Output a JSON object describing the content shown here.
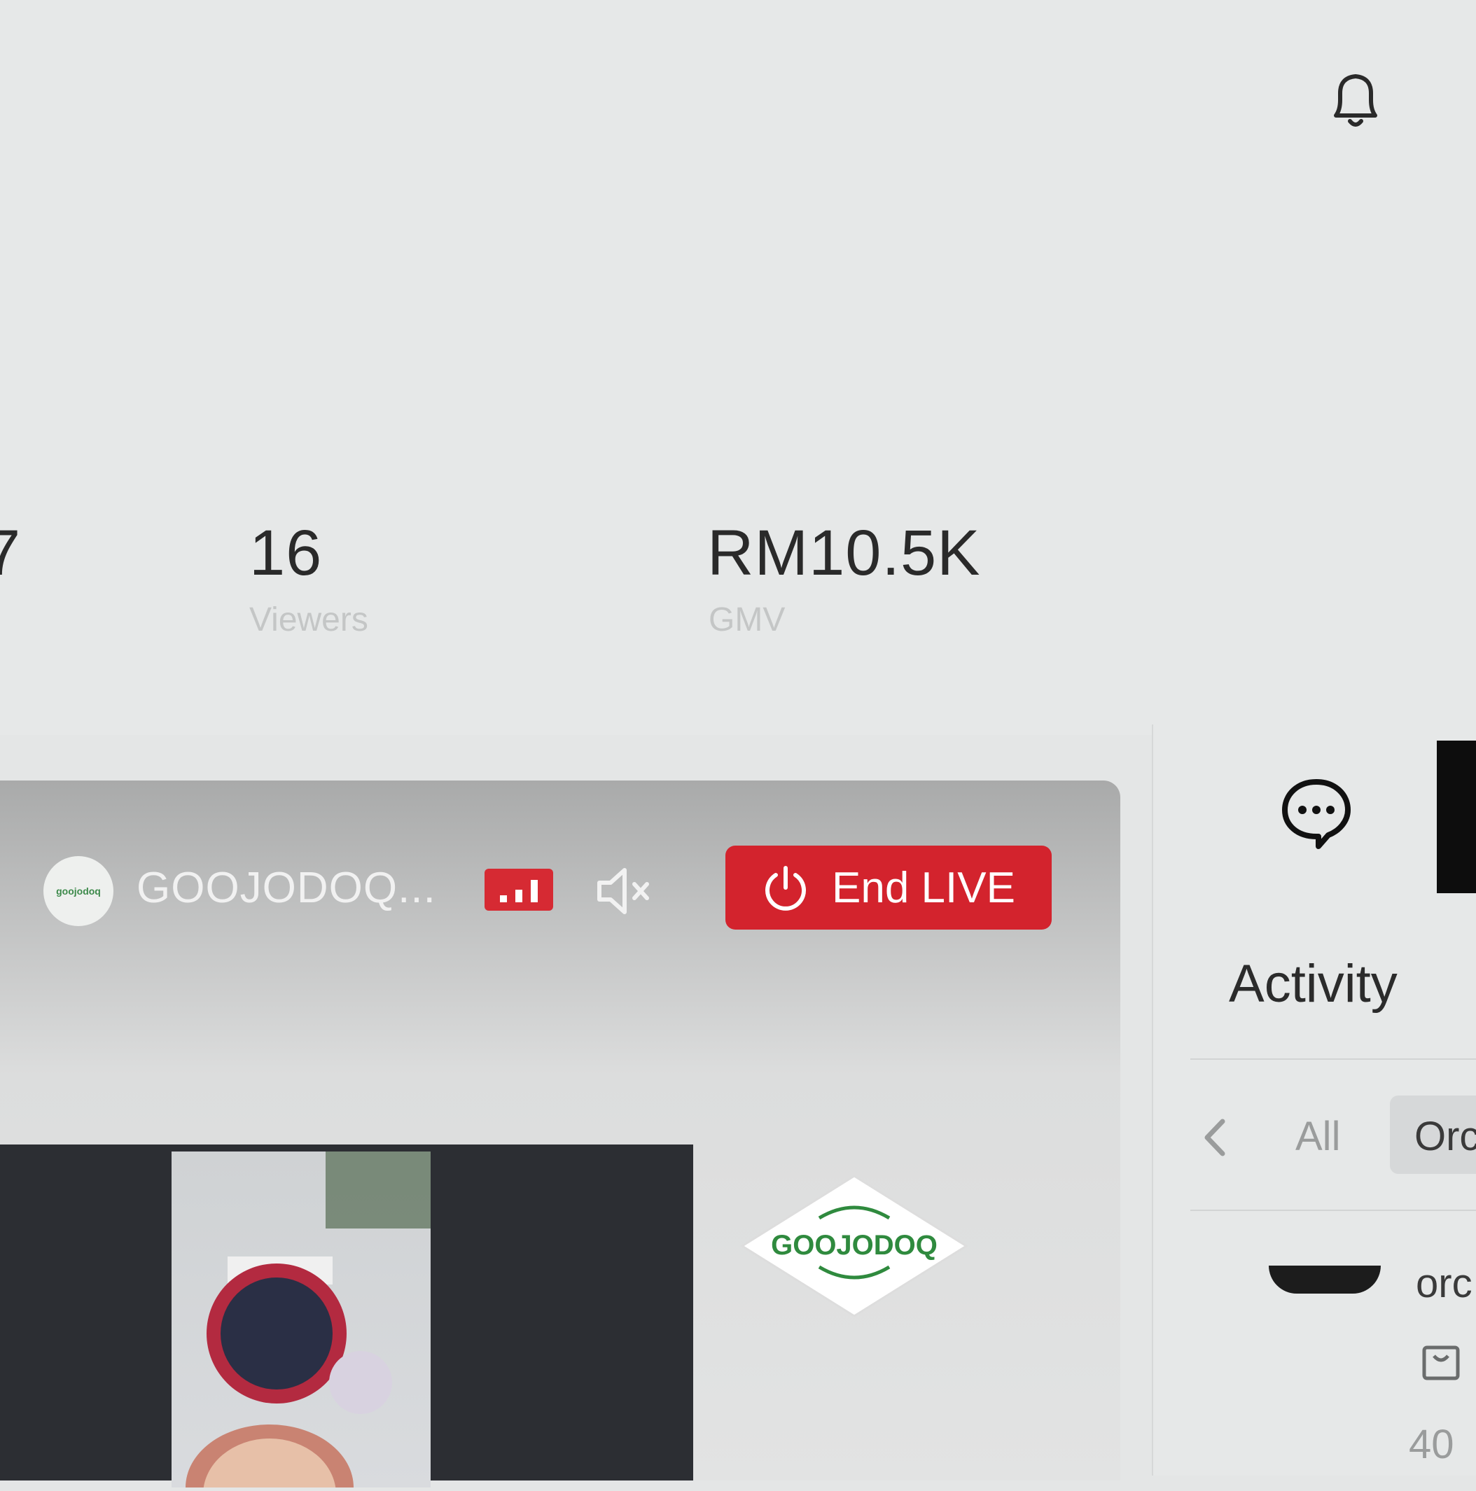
{
  "header": {
    "notification_icon": "bell-icon"
  },
  "stats": [
    {
      "value": "7",
      "label": ""
    },
    {
      "value": "16",
      "label": "Viewers"
    },
    {
      "value": "RM10.5K",
      "label": "GMV"
    }
  ],
  "live": {
    "shop_name": "GOOJODOQ...",
    "avatar_text": "goojodoq",
    "end_button_label": "End LIVE",
    "product_logo_text": "GOOJODOQ",
    "accent_color": "#d3232d"
  },
  "side_panel": {
    "title": "Activity",
    "tabs": [
      "All",
      "Orc"
    ],
    "order_preview": {
      "text": "orc",
      "amount": "40"
    }
  }
}
